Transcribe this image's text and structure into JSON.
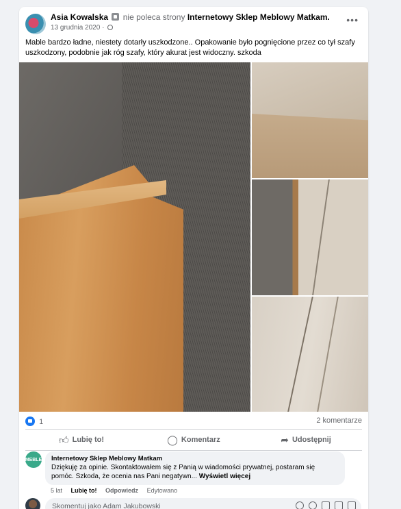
{
  "post": {
    "author_name": "Asia Kowalska",
    "verb": "nie poleca strony",
    "page_name": "Internetowy Sklep Meblowy Matkam.",
    "date": "13 grudnia 2020",
    "separator": "·",
    "more_glyph": "•••",
    "text": "Mable bardzo ładne, niestety dotarły uszkodzone.. Opakowanie było pognięcione przez co tył szafy uszkodzony, podobnie jak róg szafy, który akurat jest widoczny. szkoda",
    "reaction_count": "1",
    "comments_count": "2 komentarze"
  },
  "actions": {
    "like": "Lubię to!",
    "comment": "Komentarz",
    "share": "Udostępnij"
  },
  "comment": {
    "author": "Internetowy Sklep Meblowy Matkam",
    "avatar_text": "MEBLE",
    "text": "Dziękuję za opinie. Skontaktowałem się z Panią w wiadomości prywatnej, postaram się pomóc. Szkoda, że ocenia nas Pani negatywn...",
    "see_more": "Wyświetl więcej",
    "age": "5 lat",
    "like": "Lubię to!",
    "reply": "Odpowiedz",
    "edited": "Edytowano"
  },
  "composer": {
    "placeholder": "Skomentuj jako Adam Jakubowski"
  },
  "icons": {
    "like": "thumbs-up-icon",
    "comment": "speech-bubble-icon",
    "share": "share-arrow-icon"
  },
  "colors": {
    "accent": "#1877f2",
    "secondary_text": "#65676b",
    "background": "#f0f2f5"
  }
}
